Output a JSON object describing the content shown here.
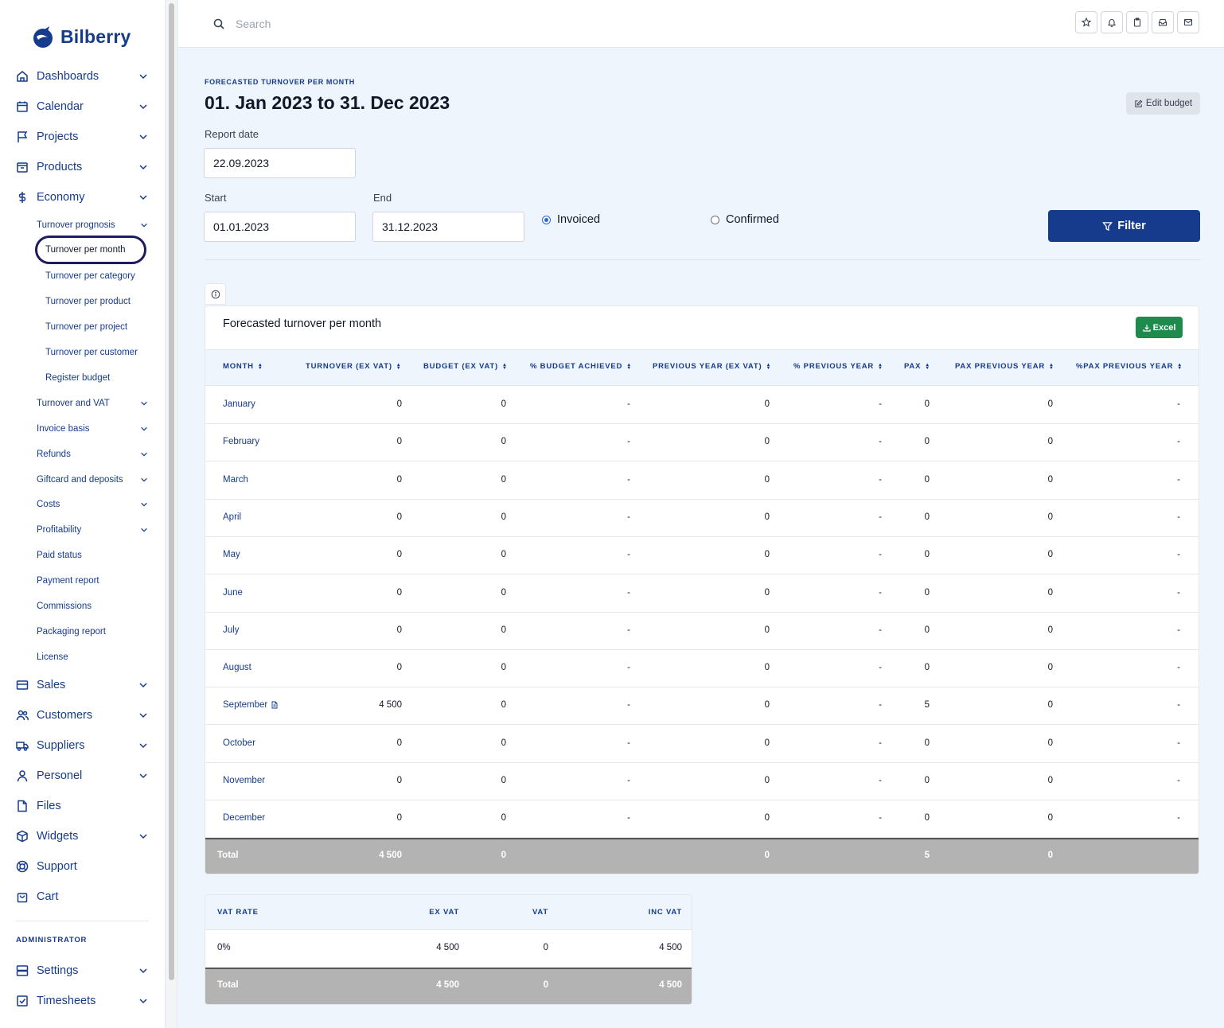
{
  "brand": {
    "name": "Bilberry"
  },
  "sidebar": {
    "main_top": [
      {
        "label": "Dashboards",
        "icon": "home-icon"
      },
      {
        "label": "Calendar",
        "icon": "calendar-icon"
      },
      {
        "label": "Projects",
        "icon": "flag-icon"
      },
      {
        "label": "Products",
        "icon": "box-icon"
      },
      {
        "label": "Economy",
        "icon": "dollar-icon"
      }
    ],
    "economy_sub": {
      "turnover_prognosis": "Turnover prognosis",
      "prognosis_items": [
        "Turnover per month",
        "Turnover per category",
        "Turnover per product",
        "Turnover per project",
        "Turnover per customer",
        "Register budget"
      ],
      "other_items": [
        "Turnover and VAT",
        "Invoice basis",
        "Refunds",
        "Giftcard and deposits",
        "Costs",
        "Profitability",
        "Paid status",
        "Payment report",
        "Commissions",
        "Packaging report",
        "License"
      ]
    },
    "main_bottom": [
      {
        "label": "Sales",
        "icon": "cash-register-icon"
      },
      {
        "label": "Customers",
        "icon": "users-icon"
      },
      {
        "label": "Suppliers",
        "icon": "truck-icon"
      },
      {
        "label": "Personel",
        "icon": "user-icon"
      },
      {
        "label": "Files",
        "icon": "file-icon"
      },
      {
        "label": "Widgets",
        "icon": "cube-icon"
      },
      {
        "label": "Support",
        "icon": "lifebuoy-icon"
      },
      {
        "label": "Cart",
        "icon": "bag-icon"
      }
    ],
    "admin_label": "ADMINISTRATOR",
    "admin_items": [
      {
        "label": "Settings",
        "icon": "server-icon"
      },
      {
        "label": "Timesheets",
        "icon": "checkbox-icon"
      }
    ]
  },
  "topbar": {
    "search_placeholder": "Search"
  },
  "header": {
    "overline": "FORECASTED TURNOVER PER MONTH",
    "title": "01. Jan 2023 to 31. Dec 2023",
    "edit_budget": "Edit budget"
  },
  "filters": {
    "report_date_label": "Report date",
    "report_date": "22.09.2023",
    "start_label": "Start",
    "start": "01.01.2023",
    "end_label": "End",
    "end": "31.12.2023",
    "radio_invoiced": "Invoiced",
    "radio_confirmed": "Confirmed",
    "selected": "Invoiced",
    "filter_button": "Filter"
  },
  "table": {
    "title": "Forecasted turnover per month",
    "excel_button": "Excel",
    "columns": [
      "MONTH",
      "TURNOVER (EX VAT)",
      "BUDGET (EX VAT)",
      "% BUDGET ACHIEVED",
      "PREVIOUS YEAR (EX VAT)",
      "% PREVIOUS YEAR",
      "PAX",
      "PAX PREVIOUS YEAR",
      "%PAX PREVIOUS YEAR"
    ],
    "rows": [
      [
        "January",
        "0",
        "0",
        "-",
        "0",
        "-",
        "0",
        "0",
        "-"
      ],
      [
        "February",
        "0",
        "0",
        "-",
        "0",
        "-",
        "0",
        "0",
        "-"
      ],
      [
        "March",
        "0",
        "0",
        "-",
        "0",
        "-",
        "0",
        "0",
        "-"
      ],
      [
        "April",
        "0",
        "0",
        "-",
        "0",
        "-",
        "0",
        "0",
        "-"
      ],
      [
        "May",
        "0",
        "0",
        "-",
        "0",
        "-",
        "0",
        "0",
        "-"
      ],
      [
        "June",
        "0",
        "0",
        "-",
        "0",
        "-",
        "0",
        "0",
        "-"
      ],
      [
        "July",
        "0",
        "0",
        "-",
        "0",
        "-",
        "0",
        "0",
        "-"
      ],
      [
        "August",
        "0",
        "0",
        "-",
        "0",
        "-",
        "0",
        "0",
        "-"
      ],
      [
        "September",
        "4 500",
        "0",
        "-",
        "0",
        "-",
        "5",
        "0",
        "-"
      ],
      [
        "October",
        "0",
        "0",
        "-",
        "0",
        "-",
        "0",
        "0",
        "-"
      ],
      [
        "November",
        "0",
        "0",
        "-",
        "0",
        "-",
        "0",
        "0",
        "-"
      ],
      [
        "December",
        "0",
        "0",
        "-",
        "0",
        "-",
        "0",
        "0",
        "-"
      ]
    ],
    "total": [
      "Total",
      "4 500",
      "0",
      "",
      "0",
      "",
      "5",
      "0",
      ""
    ]
  },
  "vat_table": {
    "columns": [
      "VAT RATE",
      "EX VAT",
      "VAT",
      "INC VAT"
    ],
    "rows": [
      [
        "0%",
        "4 500",
        "0",
        "4 500"
      ]
    ],
    "total": [
      "Total",
      "4 500",
      "0",
      "4 500"
    ]
  }
}
